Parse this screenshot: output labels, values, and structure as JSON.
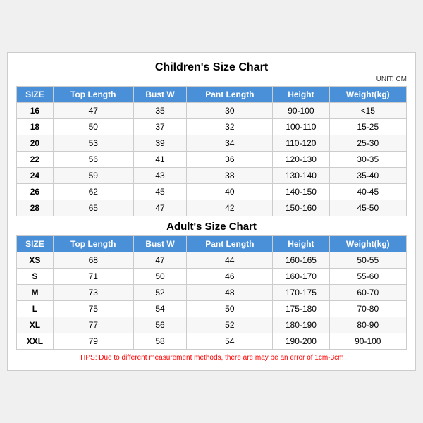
{
  "page": {
    "mainTitle": "Children's Size Chart",
    "adultTitle": "Adult's Size Chart",
    "unitLabel": "UNIT: CM",
    "tips": "TIPS: Due to different measurement methods, there are may be an error of 1cm-3cm",
    "headers": [
      "SIZE",
      "Top Length",
      "Bust W",
      "Pant Length",
      "Height",
      "Weight(kg)"
    ],
    "childrenRows": [
      [
        "16",
        "47",
        "35",
        "30",
        "90-100",
        "<15"
      ],
      [
        "18",
        "50",
        "37",
        "32",
        "100-110",
        "15-25"
      ],
      [
        "20",
        "53",
        "39",
        "34",
        "110-120",
        "25-30"
      ],
      [
        "22",
        "56",
        "41",
        "36",
        "120-130",
        "30-35"
      ],
      [
        "24",
        "59",
        "43",
        "38",
        "130-140",
        "35-40"
      ],
      [
        "26",
        "62",
        "45",
        "40",
        "140-150",
        "40-45"
      ],
      [
        "28",
        "65",
        "47",
        "42",
        "150-160",
        "45-50"
      ]
    ],
    "adultRows": [
      [
        "XS",
        "68",
        "47",
        "44",
        "160-165",
        "50-55"
      ],
      [
        "S",
        "71",
        "50",
        "46",
        "160-170",
        "55-60"
      ],
      [
        "M",
        "73",
        "52",
        "48",
        "170-175",
        "60-70"
      ],
      [
        "L",
        "75",
        "54",
        "50",
        "175-180",
        "70-80"
      ],
      [
        "XL",
        "77",
        "56",
        "52",
        "180-190",
        "80-90"
      ],
      [
        "XXL",
        "79",
        "58",
        "54",
        "190-200",
        "90-100"
      ]
    ]
  }
}
